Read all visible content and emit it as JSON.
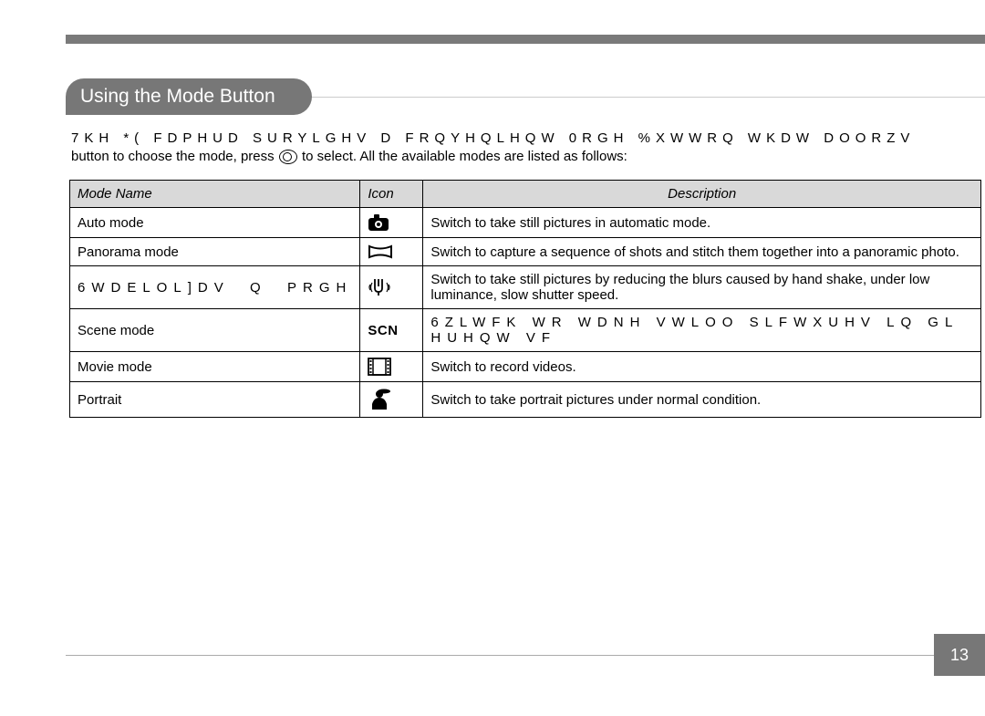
{
  "header": {
    "title": "Using the Mode Button"
  },
  "intro": {
    "line1": "7KH *( FDPHUD SURYLGHV D FRQYHQLHQW 0RGH %XWWRQ WKDW DOORZV",
    "line2a": "button to choose the mode, press",
    "line2b": "to select. All the available modes are listed as follows:"
  },
  "table": {
    "headers": {
      "name": "Mode Name",
      "icon": "Icon",
      "desc": "Description"
    },
    "rows": [
      {
        "name": "Auto mode",
        "icon": "camera",
        "desc": "Switch to take still pictures in automatic mode."
      },
      {
        "name": "Panorama mode",
        "icon": "panorama",
        "desc": "Switch to capture a sequence of shots and stitch them together into a panoramic photo."
      },
      {
        "name": "6WDELOL]DV  Q  PRGH",
        "icon": "stabilize",
        "desc": "Switch to take still pictures by reducing the blurs caused by hand shake, under low luminance, slow shutter speed."
      },
      {
        "name": "Scene mode",
        "icon": "SCN",
        "desc": "6ZLWFK WR WDNH VWLOO SLFWXUHV LQ   GL HUHQW VF"
      },
      {
        "name": "Movie mode",
        "icon": "film",
        "desc": "Switch to record videos."
      },
      {
        "name": "Portrait",
        "icon": "portrait",
        "desc": "Switch to take portrait pictures under normal condition."
      }
    ]
  },
  "page_number": "13"
}
